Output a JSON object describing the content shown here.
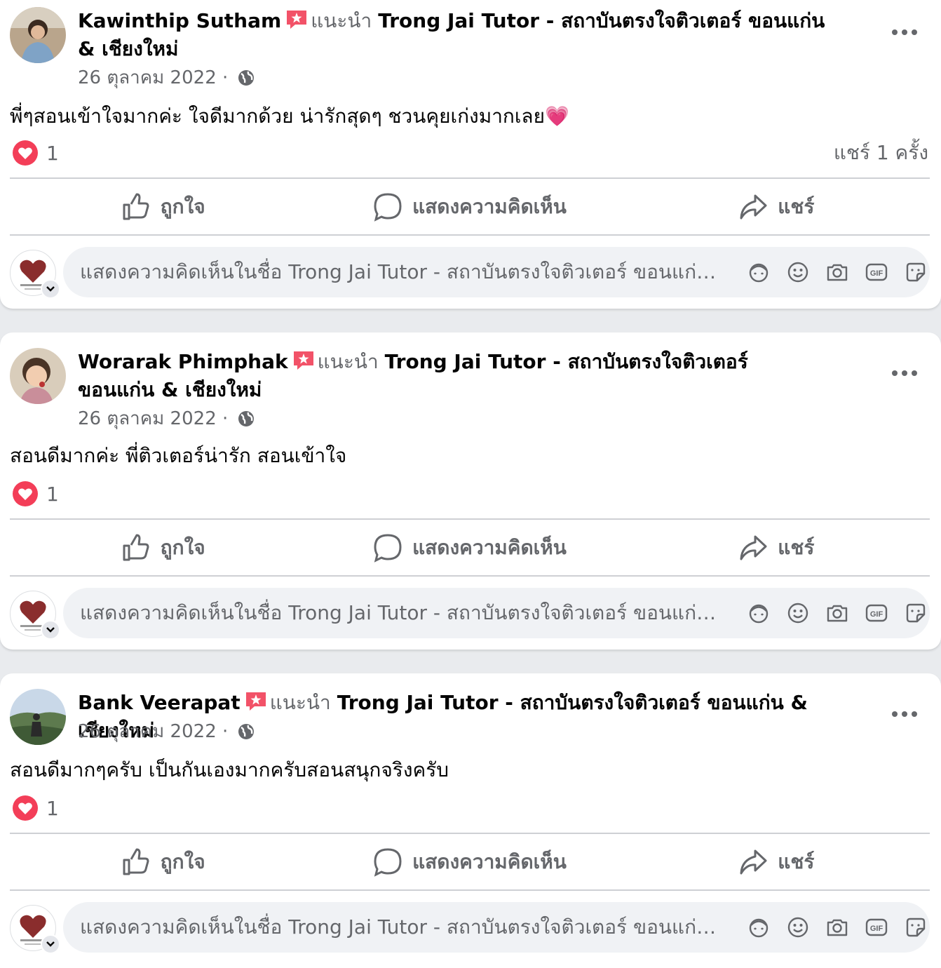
{
  "colors": {
    "text_primary": "#050505",
    "text_secondary": "#65676b",
    "heart": "#f33e58",
    "badge": "#f25268",
    "input_bg": "#f0f2f5"
  },
  "shared": {
    "recommend_word": "แนะนำ",
    "page_name": "Trong Jai Tutor - สถาบันตรงใจติวเตอร์ ขอนแก่น & เชียงใหม่",
    "actions": {
      "like": "ถูกใจ",
      "comment": "แสดงความคิดเห็น",
      "share": "แชร์"
    },
    "comment_placeholder": "แสดงความคิดเห็นในชื่อ Trong Jai Tutor - สถาบันตรงใจติวเตอร์ ขอนแก่น & เชียงใหม่",
    "comment_icons": [
      "avatar-sticker-icon",
      "emoji-icon",
      "camera-icon",
      "gif-icon",
      "sticker-icon"
    ]
  },
  "posts": [
    {
      "author": "Kawinthip Sutham",
      "date": "26 ตุลาคม 2022 ·",
      "text": "พี่ๆสอนเข้าใจมากค่ะ ใจดีมากด้วย น่ารักสุดๆ ชวนคุยเก่งมากเลย💗",
      "reactions": "1",
      "shares": "แชร์ 1 ครั้ง"
    },
    {
      "author": "Worarak Phimphak",
      "date": "26 ตุลาคม 2022 ·",
      "text": "สอนดีมากค่ะ พี่ติวเตอร์น่ารัก สอนเข้าใจ",
      "reactions": "1"
    },
    {
      "author": "Bank Veerapat",
      "date": "26 ตุลาคม 2022 ·",
      "text": "สอนดีมากๆครับ เป็นกันเองมากครับสอนสนุกจริงครับ",
      "reactions": "1"
    }
  ]
}
